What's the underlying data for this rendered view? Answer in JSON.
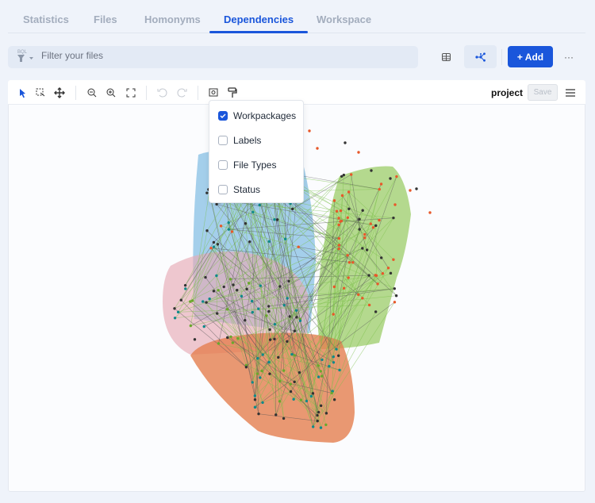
{
  "tabs": [
    {
      "label": "Statistics"
    },
    {
      "label": "Files"
    },
    {
      "label": "Homonyms"
    },
    {
      "label": "Dependencies",
      "active": true
    },
    {
      "label": "Workspace"
    }
  ],
  "filter": {
    "badge": "BQL",
    "placeholder": "Filter your files"
  },
  "actions": {
    "add_label": "+ Add",
    "more_label": "···"
  },
  "toolbar": {
    "project_label": "project",
    "save_label": "Save"
  },
  "menu": {
    "items": [
      {
        "label": "Workpackages",
        "checked": true
      },
      {
        "label": "Labels",
        "checked": false
      },
      {
        "label": "File Types",
        "checked": false
      },
      {
        "label": "Status",
        "checked": false
      }
    ]
  },
  "colors": {
    "accent": "#1a56db",
    "blue_group": "#8ec3e6",
    "pink_group": "#e9b3bd",
    "green_group": "#a9d27a",
    "orange_group": "#e88a5c"
  }
}
